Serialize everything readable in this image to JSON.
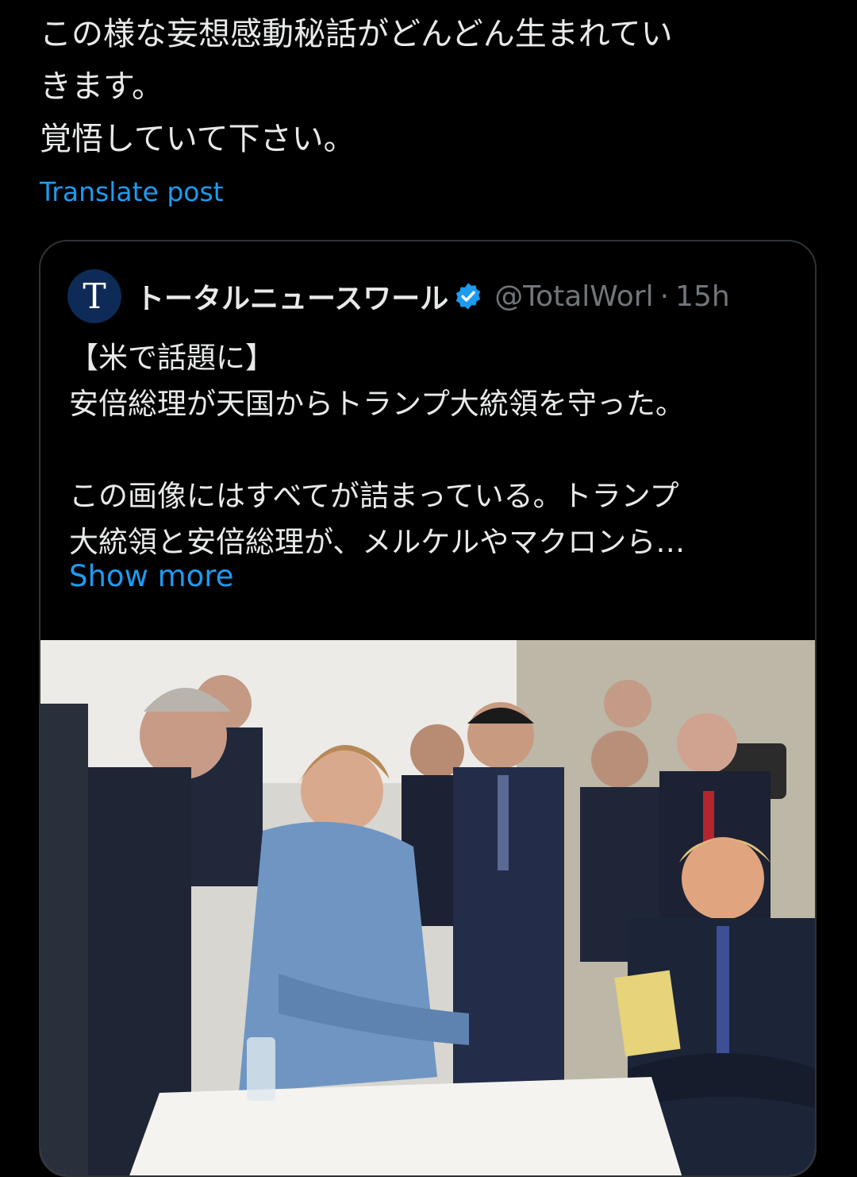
{
  "post": {
    "lines": [
      "この様な妄想感動秘話がどんどん生まれてい",
      "きます。",
      "覚悟していて下さい。"
    ],
    "translate_label": "Translate post"
  },
  "quote": {
    "avatar_letter": "T",
    "name": "トータルニュースワール",
    "handle": "@TotalWorl",
    "separator": "·",
    "time": "15h",
    "body_lines": [
      "【米で話題に】",
      "安倍総理が天国からトランプ大統領を守った。",
      "",
      "この画像にはすべてが詰まっている。トランプ",
      "大統領と安倍総理が、メルケルやマクロンら…"
    ],
    "show_more_label": "Show more"
  },
  "colors": {
    "background": "#000000",
    "text": "#e7e9ea",
    "link": "#1d9bf0",
    "muted": "#71767b",
    "border": "#2f3336",
    "verified": "#1d9bf0"
  }
}
